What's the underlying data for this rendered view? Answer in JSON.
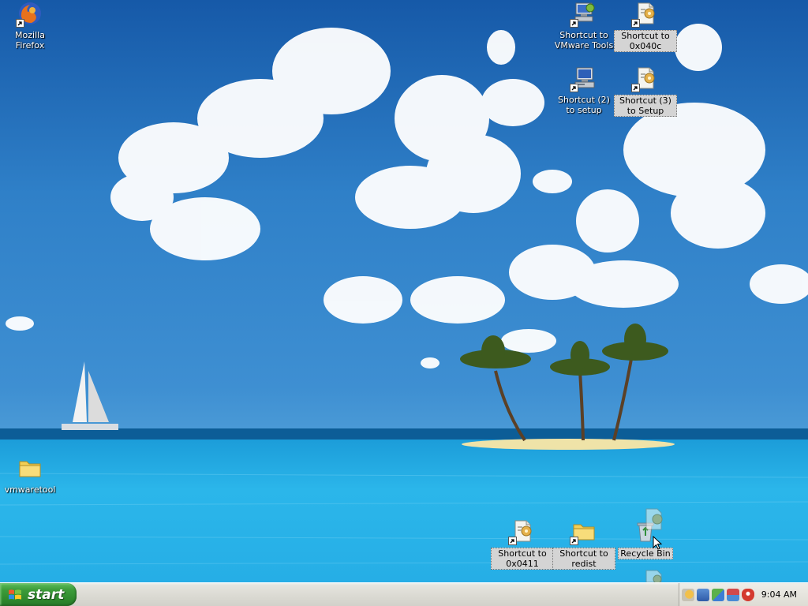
{
  "desktop": {
    "icons": [
      {
        "id": "firefox",
        "label": "Mozilla Firefox",
        "icon": "firefox-icon",
        "shortcut": true,
        "selected": false
      },
      {
        "id": "vmware-tools",
        "label": "Shortcut to VMware Tools",
        "icon": "vmware-tools-icon",
        "shortcut": true,
        "selected": false
      },
      {
        "id": "0x040c",
        "label": "Shortcut to 0x040c",
        "icon": "setup-file-icon",
        "shortcut": true,
        "selected": true
      },
      {
        "id": "setup2",
        "label": "Shortcut (2) to setup",
        "icon": "computer-setup-icon",
        "shortcut": true,
        "selected": false
      },
      {
        "id": "setup3",
        "label": "Shortcut (3) to Setup",
        "icon": "setup-file-icon",
        "shortcut": true,
        "selected": true
      },
      {
        "id": "vmwaretool",
        "label": "vmwaretool",
        "icon": "folder-icon",
        "shortcut": false,
        "selected": false
      },
      {
        "id": "0x0411",
        "label": "Shortcut to 0x0411",
        "icon": "setup-file-icon",
        "shortcut": true,
        "selected": true
      },
      {
        "id": "redist",
        "label": "Shortcut to redist",
        "icon": "folder-icon",
        "shortcut": true,
        "selected": true
      },
      {
        "id": "recycle-bin",
        "label": "Recycle Bin",
        "icon": "recycle-bin-icon",
        "shortcut": false,
        "selected": true
      }
    ]
  },
  "taskbar": {
    "start_label": "start",
    "clock": "9:04 AM",
    "tray_icons": [
      "setup-tray-icon",
      "network-tray-icon",
      "update-tray-icon",
      "vmware-tray-icon",
      "security-shield-icon"
    ]
  },
  "colors": {
    "sky_top": "#1e6cb8",
    "sea": "#1ea7e0",
    "start_green": "#3c9c3a",
    "selection_bg": "#d4d4d4"
  }
}
